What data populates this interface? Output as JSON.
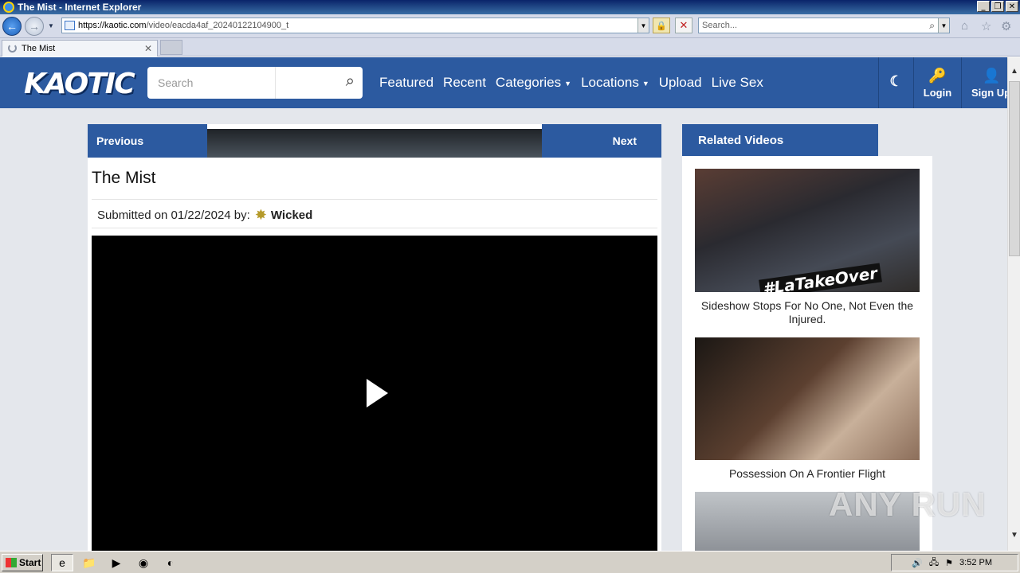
{
  "window": {
    "title": "The Mist - Internet Explorer"
  },
  "browser": {
    "address_host": "https://kaotic.com",
    "address_path": "/video/eacda4af_20240122104900_t",
    "search_placeholder": "Search...",
    "tab_title": "The Mist"
  },
  "header": {
    "logo_text": "KAOTIC",
    "search_placeholder": "Search",
    "nav": [
      "Featured",
      "Recent",
      "Categories",
      "Locations",
      "Upload",
      "Live Sex"
    ],
    "login_label": "Login",
    "signup_label": "Sign Up"
  },
  "video": {
    "prev_label": "Previous",
    "next_label": "Next",
    "title": "The Mist",
    "submitted_prefix": "Submitted on 01/22/2024 by:",
    "author": "Wicked"
  },
  "related": {
    "header": "Related Videos",
    "items": [
      {
        "title": "Sideshow Stops For No One, Not Even the Injured.",
        "overlay_text": "#LaTakeOver"
      },
      {
        "title": "Possession On A Frontier Flight"
      }
    ]
  },
  "watermark": "ANY RUN",
  "taskbar": {
    "start_label": "Start",
    "clock": "3:52 PM"
  }
}
